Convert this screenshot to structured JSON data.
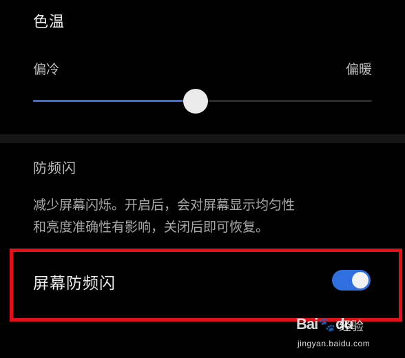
{
  "color_temperature": {
    "title": "色温",
    "left_label": "偏冷",
    "right_label": "偏暖",
    "slider_value_fraction": 0.48
  },
  "anti_flicker": {
    "title": "防频闪",
    "description_line1": "减少屏幕闪烁。开启后，会对屏幕显示均匀性",
    "description_line2": "和亮度准确性有影响，关闭后即可恢复。",
    "toggle_label": "屏幕防频闪",
    "toggle_on": true
  },
  "colors": {
    "accent": "#2f6fe0",
    "slider_fill": "#3f6fd6",
    "highlight_border": "#e3101a",
    "background": "#000000"
  },
  "watermark": {
    "logo_a": "Bai",
    "logo_paw": "🐾",
    "logo_b": "du",
    "logo_sub": "经验",
    "url": "jingyan.baidu.com"
  }
}
